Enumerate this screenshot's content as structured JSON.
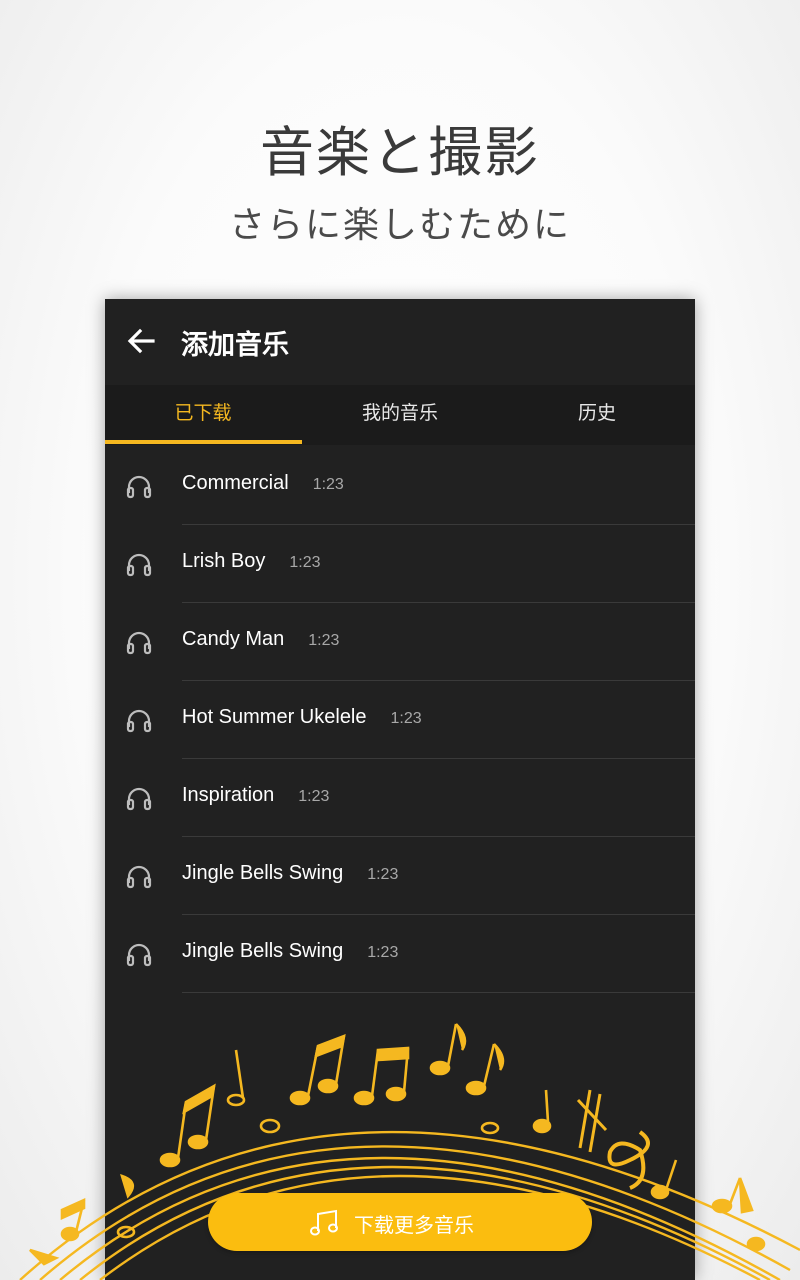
{
  "promo": {
    "headline": "音楽と撮影",
    "subline": "さらに楽しむために"
  },
  "appbar": {
    "title": "添加音乐",
    "back_icon": "arrow-left-icon"
  },
  "tabs": [
    {
      "label": "已下载",
      "active": true
    },
    {
      "label": "我的音乐",
      "active": false
    },
    {
      "label": "历史",
      "active": false
    }
  ],
  "tracks": [
    {
      "name": "Commercial",
      "duration": "1:23"
    },
    {
      "name": "Lrish Boy",
      "duration": "1:23"
    },
    {
      "name": "Candy Man",
      "duration": "1:23"
    },
    {
      "name": "Hot Summer Ukelele",
      "duration": "1:23"
    },
    {
      "name": "Inspiration",
      "duration": "1:23"
    },
    {
      "name": "Jingle Bells Swing",
      "duration": "1:23"
    },
    {
      "name": "Jingle Bells Swing",
      "duration": "1:23"
    }
  ],
  "cta": {
    "label": "下载更多音乐",
    "icon": "music-note-icon"
  },
  "colors": {
    "accent": "#f5b820",
    "panel_bg": "#212121",
    "tab_bar_bg": "#1b1b1b",
    "button_bg": "#fbbd0f"
  }
}
